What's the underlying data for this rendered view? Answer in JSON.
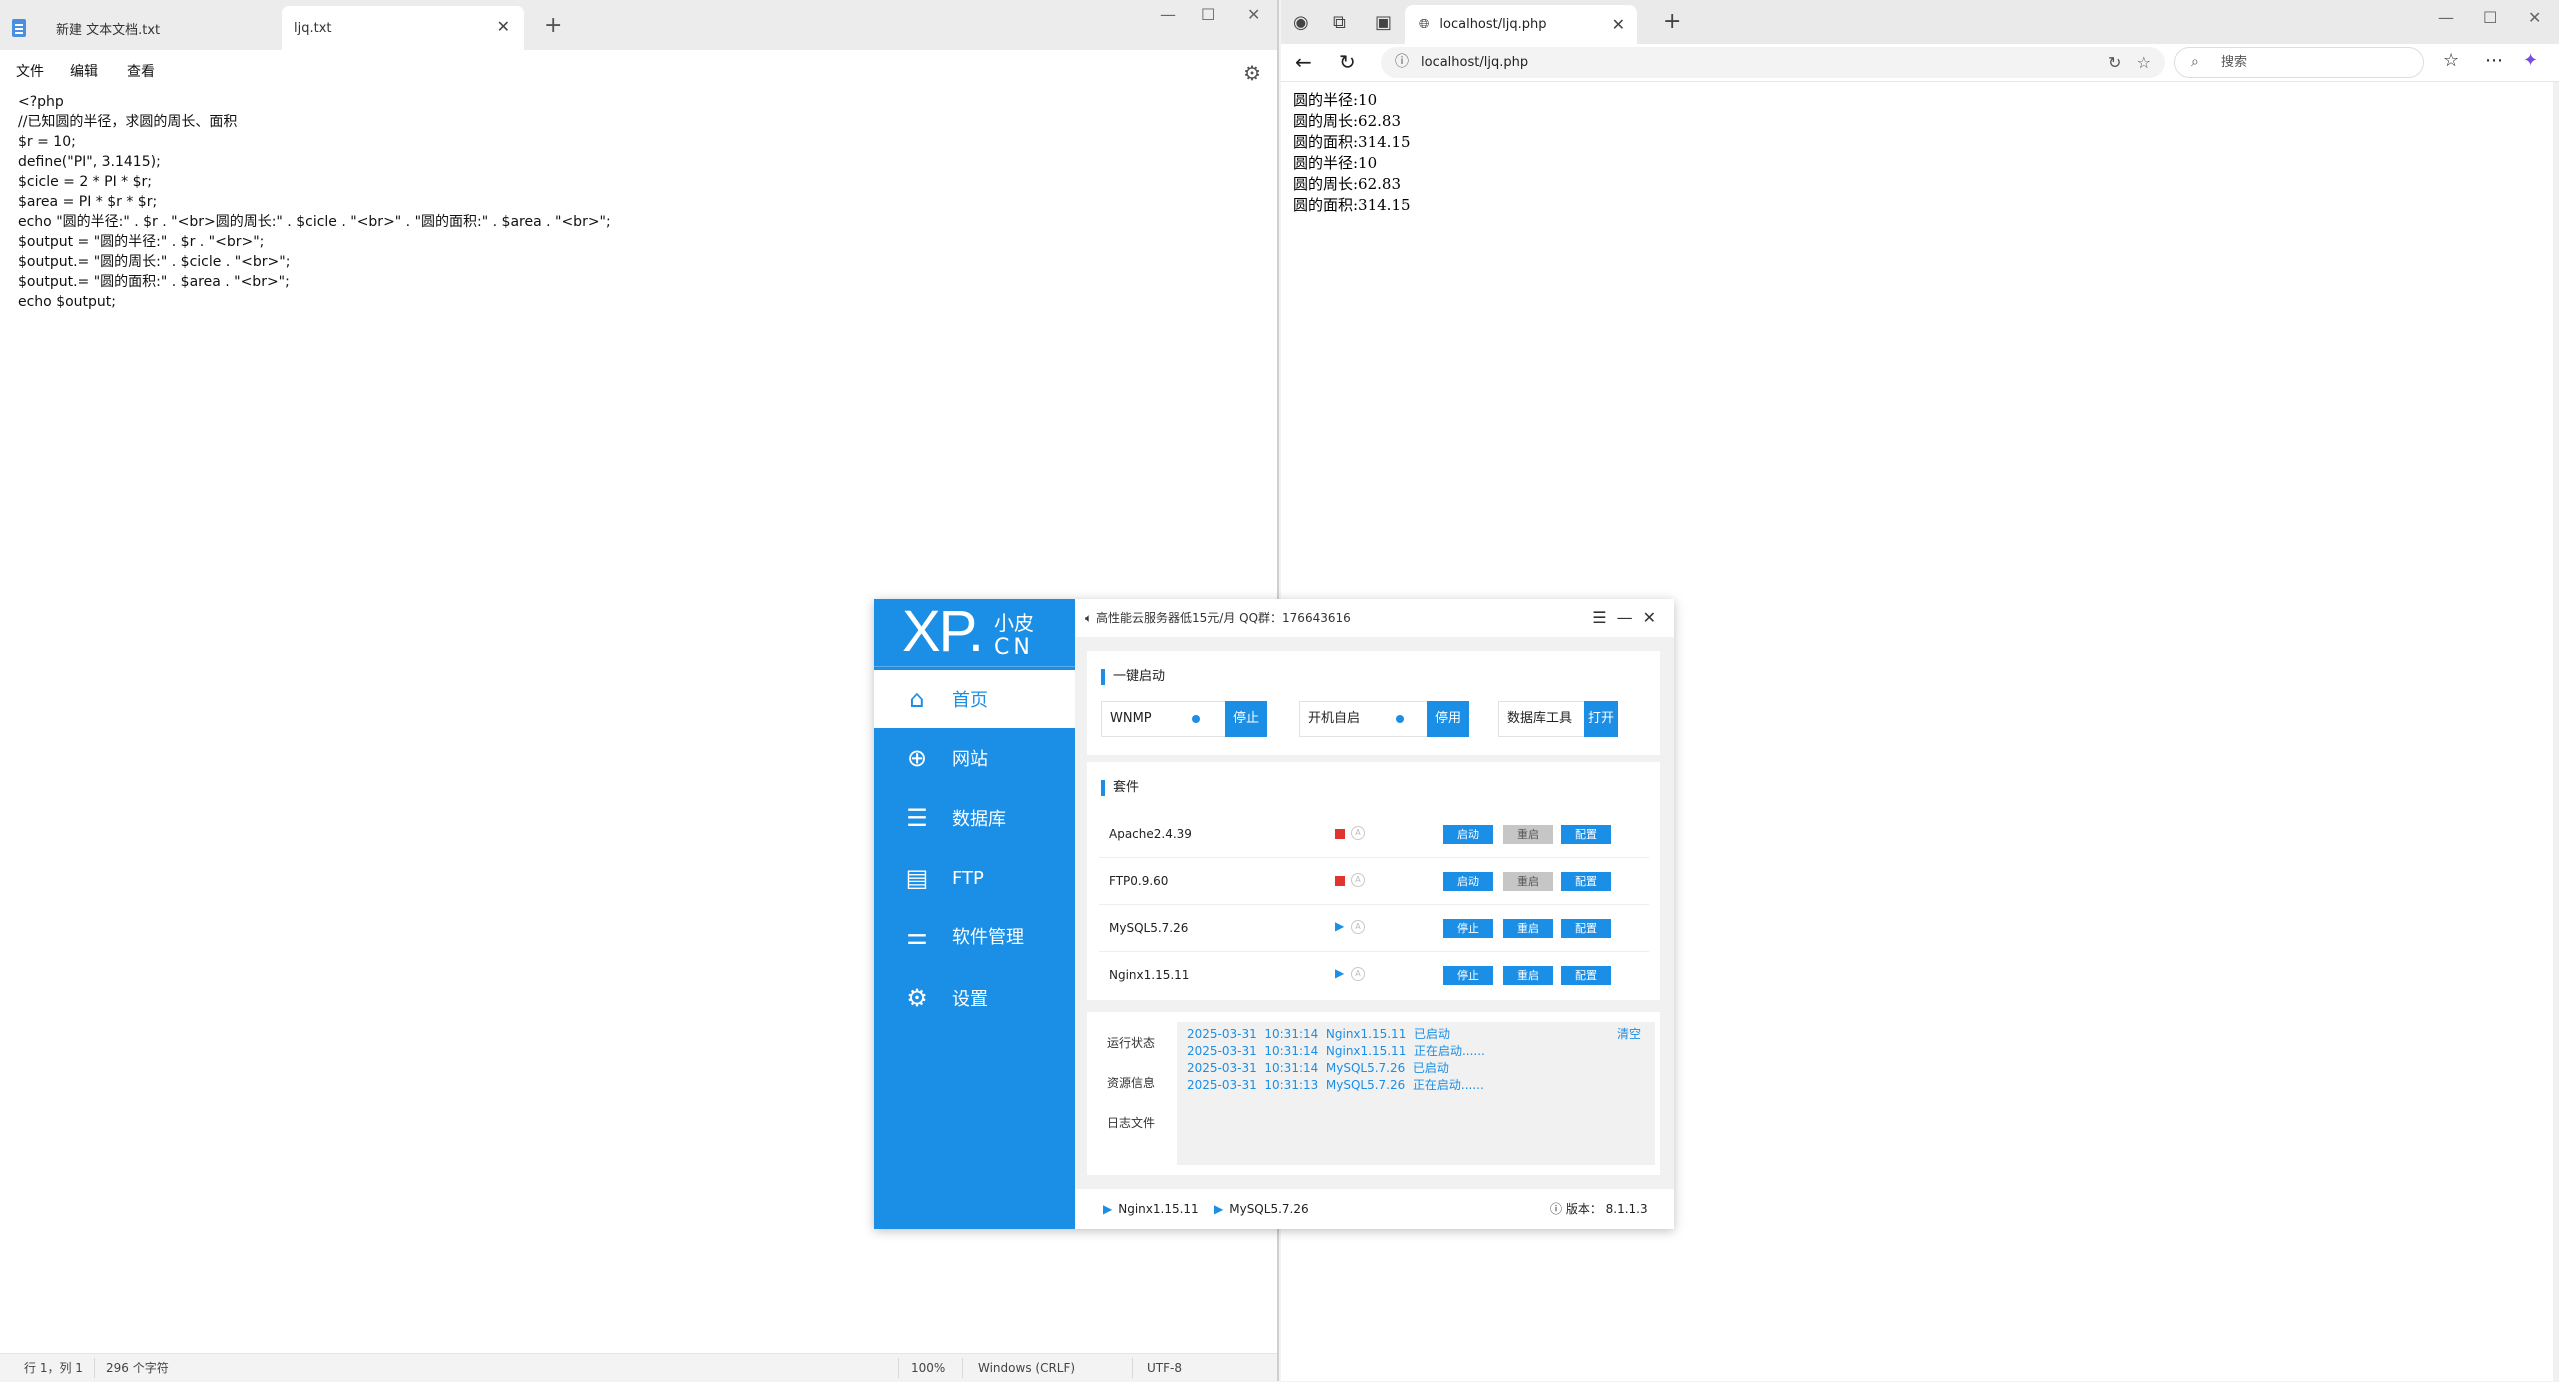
{
  "notepad": {
    "tabs": [
      {
        "label": "新建 文本文档.txt"
      },
      {
        "label": "ljq.txt"
      }
    ],
    "menu": [
      "文件",
      "编辑",
      "查看"
    ],
    "lines": [
      "<?php",
      "//已知圆的半径，求圆的周长、面积",
      "$r = 10;",
      "define(\"PI\", 3.1415);",
      "$cicle = 2 * PI * $r;",
      "$area = PI * $r * $r;",
      "echo \"圆的半径:\" . $r . \"<br>圆的周长:\" . $cicle . \"<br>\" . \"圆的面积:\" . $area . \"<br>\";",
      "$output = \"圆的半径:\" . $r . \"<br>\";",
      "$output.= \"圆的周长:\" . $cicle . \"<br>\";",
      "$output.= \"圆的面积:\" . $area . \"<br>\";",
      "echo $output;"
    ],
    "status": {
      "position": "行 1，列 1",
      "chars": "296 个字符",
      "zoom": "100%",
      "eol": "Windows (CRLF)",
      "encoding": "UTF-8"
    }
  },
  "browser": {
    "tab_title": "localhost/ljq.php",
    "address": "localhost/ljq.php",
    "search_placeholder": "搜索",
    "content_lines": [
      "圆的半径:10",
      "圆的周长:62.83",
      "圆的面积:314.15",
      "圆的半径:10",
      "圆的周长:62.83",
      "圆的面积:314.15"
    ]
  },
  "xp": {
    "logo": {
      "big": "XP.",
      "top": "小皮",
      "bottom": "CN"
    },
    "nav": [
      {
        "label": "首页",
        "icon": "home-icon",
        "glyph": "⌂"
      },
      {
        "label": "网站",
        "icon": "globe-icon",
        "glyph": "⊕"
      },
      {
        "label": "数据库",
        "icon": "database-icon",
        "glyph": "☰"
      },
      {
        "label": "FTP",
        "icon": "ftp-icon",
        "glyph": "▤"
      },
      {
        "label": "软件管理",
        "icon": "sliders-icon",
        "glyph": "⚌"
      },
      {
        "label": "设置",
        "icon": "gear-icon",
        "glyph": "⚙"
      }
    ],
    "top_ad": "高性能云服务器低15元/月   QQ群：176643616",
    "quick": {
      "title": "一键启动",
      "wnmp_label": "WNMP",
      "wnmp_btn": "停止",
      "autostart_label": "开机自启",
      "autostart_btn": "停用",
      "dbtool_label": "数据库工具",
      "dbtool_btn": "打开"
    },
    "suite": {
      "title": "套件",
      "rows": [
        {
          "name": "Apache2.4.39",
          "state": "stopped",
          "b1": "启动",
          "b2": "重启",
          "b3": "配置"
        },
        {
          "name": "FTP0.9.60",
          "state": "stopped",
          "b1": "启动",
          "b2": "重启",
          "b3": "配置"
        },
        {
          "name": "MySQL5.7.26",
          "state": "running",
          "b1": "停止",
          "b2": "重启",
          "b3": "配置"
        },
        {
          "name": "Nginx1.15.11",
          "state": "running",
          "b1": "停止",
          "b2": "重启",
          "b3": "配置"
        }
      ]
    },
    "log": {
      "tabs": [
        "运行状态",
        "资源信息",
        "日志文件"
      ],
      "clear": "清空",
      "lines": [
        "2025-03-31  10:31:14  Nginx1.15.11  已启动",
        "2025-03-31  10:31:14  Nginx1.15.11  正在启动......",
        "2025-03-31  10:31:14  MySQL5.7.26  已启动",
        "2025-03-31  10:31:13  MySQL5.7.26  正在启动......"
      ]
    },
    "bottom": {
      "nginx": "Nginx1.15.11",
      "mysql": "MySQL5.7.26",
      "version": "版本： 8.1.1.3"
    }
  }
}
